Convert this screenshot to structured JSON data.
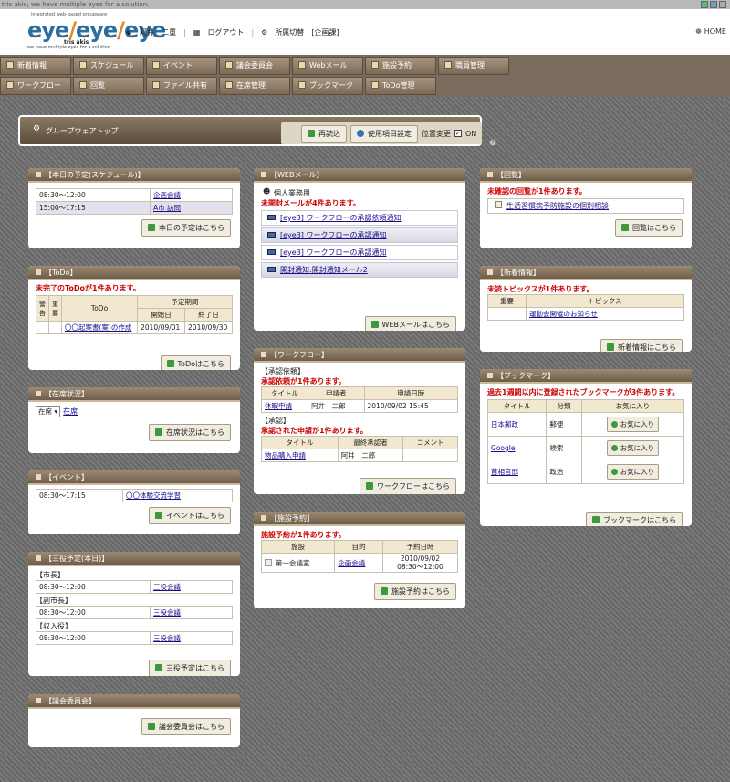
{
  "topbar": {
    "text": "tris akis; we have multiple eyes for a solution."
  },
  "header": {
    "logo_sub": "integrated web-based groupware",
    "logo_tris": "tris akis",
    "logo_tag": "we have multiple eyes for a solution",
    "user": "阿井　二重",
    "logout": "ログアウト",
    "switch": "所属切替",
    "dept": "[企画課]",
    "home": "HOME"
  },
  "menu": [
    "新着情報",
    "スケジュール",
    "イベント",
    "議会委員会",
    "Webメール",
    "施設予約",
    "職員管理",
    "ワークフロー",
    "回覧",
    "ファイル共有",
    "在席管理",
    "ブックマーク",
    "ToDo管理"
  ],
  "gbox": {
    "title": "グループウェアトップ",
    "reload": "再読込",
    "settings": "使用項目設定",
    "pos": "位置変更",
    "on": "ON"
  },
  "schedule": {
    "title": "【本日の予定(スケジュール)】",
    "rows": [
      {
        "time": "08:30～12:00",
        "title": "企画会議"
      },
      {
        "time": "15:00～17:15",
        "title": "A市 訪問"
      }
    ],
    "btn": "本日の予定はこちら"
  },
  "todo": {
    "title": "【ToDo】",
    "msg": "未完了のToDoが1件あります。",
    "h_warn": "警告",
    "h_imp": "重要",
    "h_todo": "ToDo",
    "h_period": "予定期間",
    "h_start": "開始日",
    "h_end": "終了日",
    "row": {
      "title": "〇〇起案書(案)の作成",
      "start": "2010/09/01",
      "end": "2010/09/30"
    },
    "btn": "ToDoはこちら"
  },
  "presence": {
    "title": "【在席状況】",
    "select": "在席",
    "link": "在席",
    "btn": "在席状況はこちら"
  },
  "event": {
    "title": "【イベント】",
    "time": "08:30～17:15",
    "name": "〇〇体験交流学習",
    "btn": "イベントはこちら"
  },
  "sanyaku": {
    "title": "【三役予定(本日)】",
    "groups": [
      {
        "role": "【市長】",
        "time": "08:30～12:00",
        "item": "三役会議"
      },
      {
        "role": "【副市長】",
        "time": "08:30～12:00",
        "item": "三役会議"
      },
      {
        "role": "【収入役】",
        "time": "08:30～12:00",
        "item": "三役会議"
      }
    ],
    "btn": "三役予定はこちら"
  },
  "council": {
    "title": "【議会委員会】",
    "btn": "議会委員会はこちら"
  },
  "webmail": {
    "title": "【WEBメール】",
    "account": "個人業務用",
    "msg": "未開封メールが4件あります。",
    "mails": [
      "[eye3] ワークフローの承認依頼通知",
      "[eye3] ワークフローの承認通知",
      "[eye3] ワークフローの承認通知",
      "開封通知:開封通知メール2"
    ],
    "btn": "WEBメールはこちら"
  },
  "workflow": {
    "title": "【ワークフロー】",
    "req_title": "【承認依頼】",
    "req_msg": "承認依頼が1件あります。",
    "h1": [
      "タイトル",
      "申請者",
      "申請日時"
    ],
    "req_row": [
      "休暇申請",
      "阿井　二郎",
      "2010/09/02 15:45"
    ],
    "app_title": "【承認】",
    "app_msg": "承認された申請が1件あります。",
    "h2": [
      "タイトル",
      "最終承認者",
      "コメント"
    ],
    "app_row": [
      "物品購入申請",
      "阿井　二郎",
      ""
    ],
    "btn": "ワークフローはこちら"
  },
  "facility": {
    "title": "【施設予約】",
    "msg": "施設予約が1件あります。",
    "h": [
      "施設",
      "目的",
      "予約日時"
    ],
    "row": {
      "name": "第一会議室",
      "purpose": "企画会議",
      "date": "2010/09/02",
      "time": "08:30～12:00"
    },
    "btn": "施設予約はこちら"
  },
  "circular": {
    "title": "【回覧】",
    "msg": "未確認の回覧が1件あります。",
    "item": "生活習慣病予防施設の個別相談",
    "btn": "回覧はこちら"
  },
  "news": {
    "title": "【新着情報】",
    "msg": "未読トピックスが1件あります。",
    "h": [
      "重要",
      "トピックス"
    ],
    "item": "運動会開催のお知らせ",
    "btn": "新着情報はこちら"
  },
  "bookmark": {
    "title": "【ブックマーク】",
    "msg": "過去1週間以内に登録されたブックマークが3件あります。",
    "h": [
      "タイトル",
      "分類",
      "お気に入り"
    ],
    "rows": [
      {
        "title": "日本郵政",
        "cat": "郵便"
      },
      {
        "title": "Google",
        "cat": "検索"
      },
      {
        "title": "首相官邸",
        "cat": "政治"
      }
    ],
    "fav": "お気に入り",
    "btn": "ブックマークはこちら"
  }
}
